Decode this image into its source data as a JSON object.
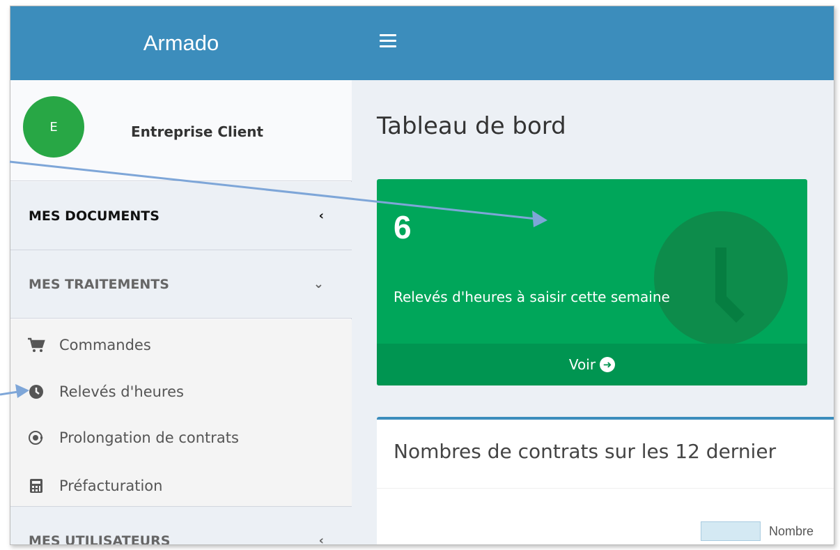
{
  "app": {
    "title": "Armado"
  },
  "user": {
    "avatar_letter": "E",
    "name": "Entreprise Client"
  },
  "sidebar": {
    "sections": {
      "documents": {
        "label": "MES DOCUMENTS",
        "chevron": "‹"
      },
      "traitements": {
        "label": "MES TRAITEMENTS",
        "chevron": "⌄"
      },
      "utilisateurs": {
        "label": "MES UTILISATEURS",
        "chevron": "‹"
      }
    },
    "items": [
      {
        "label": "Commandes",
        "icon": "cart-icon"
      },
      {
        "label": "Relevés d'heures",
        "icon": "clock-icon"
      },
      {
        "label": "Prolongation de contrats",
        "icon": "contract-extend-icon"
      },
      {
        "label": "Préfacturation",
        "icon": "calculator-icon"
      }
    ]
  },
  "main": {
    "title": "Tableau de bord",
    "stat_box": {
      "count": "6",
      "text": "Relevés d'heures à saisir cette semaine",
      "link": "Voir",
      "icon": "clock-icon"
    },
    "chart_box": {
      "title": "Nombres de contrats sur les 12 dernier",
      "legend_label": "Nombre"
    }
  },
  "colors": {
    "header": "#3c8dbc",
    "success": "#00a65a",
    "avatar": "#28a745",
    "annotation_arrow": "#7ea6d8"
  }
}
